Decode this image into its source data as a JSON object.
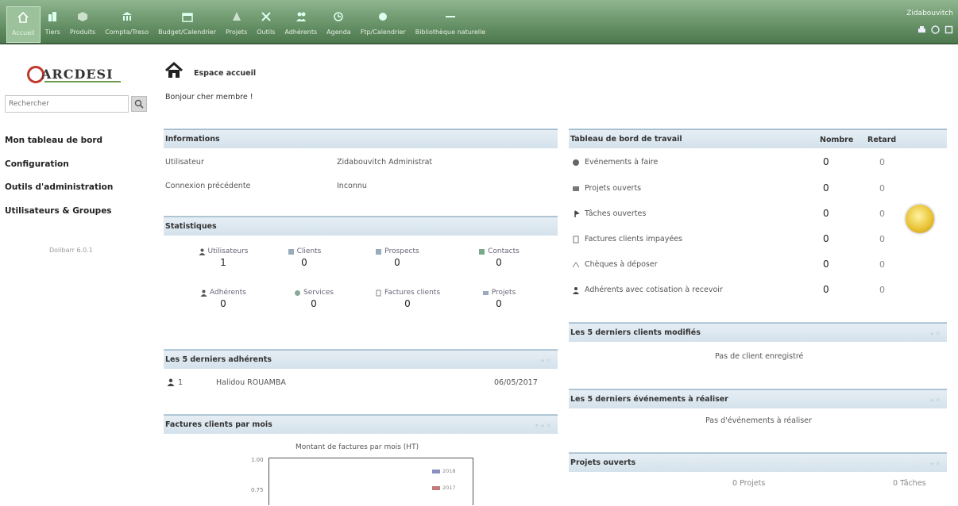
{
  "topbar": {
    "menu": [
      {
        "label": "Accueil",
        "icon": "home-icon"
      },
      {
        "label": "Tiers",
        "icon": "company-icon"
      },
      {
        "label": "Produits",
        "icon": "box-icon"
      },
      {
        "label": "Compta/Treso",
        "icon": "bank-icon"
      },
      {
        "label": "Budget/Calendrier",
        "icon": "calendar-icon"
      },
      {
        "label": "Projets",
        "icon": "project-icon"
      },
      {
        "label": "Outils",
        "icon": "tools-icon"
      },
      {
        "label": "Adhérents",
        "icon": "members-icon"
      },
      {
        "label": "Agenda",
        "icon": "agenda-icon"
      },
      {
        "label": "Ftp/Calendrier",
        "icon": "ftp-icon"
      },
      {
        "label": "Bibliothèque naturelle",
        "icon": "library-icon"
      }
    ],
    "user": "Zidabouvitch"
  },
  "left": {
    "logo_text": "ARCDESI",
    "search_placeholder": "Rechercher",
    "links": [
      "Mon tableau de bord",
      "Configuration",
      "Outils d'administration",
      "Utilisateurs & Groupes"
    ],
    "version": "Dolibarr 6.0.1"
  },
  "page": {
    "title": "Espace accueil",
    "greeting": "Bonjour cher membre !"
  },
  "informations": {
    "title": "Informations",
    "rows": [
      {
        "label": "Utilisateur",
        "value": "Zidabouvitch Administrat"
      },
      {
        "label": "Connexion précédente",
        "value": "Inconnu"
      }
    ]
  },
  "statistiques": {
    "title": "Statistiques",
    "items": [
      {
        "label": "Utilisateurs",
        "value": "1",
        "icon": "user-icon"
      },
      {
        "label": "Clients",
        "value": "0",
        "icon": "clients-icon"
      },
      {
        "label": "Prospects",
        "value": "0",
        "icon": "prospects-icon"
      },
      {
        "label": "Contacts",
        "value": "0",
        "icon": "contacts-icon"
      },
      {
        "label": "Adhérents",
        "value": "0",
        "icon": "member-icon"
      },
      {
        "label": "Services",
        "value": "0",
        "icon": "services-icon"
      },
      {
        "label": "Factures clients",
        "value": "0",
        "icon": "invoice-icon"
      },
      {
        "label": "Projets",
        "value": "0",
        "icon": "projects-icon"
      }
    ]
  },
  "adherents": {
    "title": "Les 5 derniers adhérents",
    "rows": [
      {
        "id": "1",
        "name": "Halidou ROUAMBA",
        "date": "06/05/2017"
      }
    ]
  },
  "factures": {
    "title": "Factures clients par mois",
    "chart_title": "Montant de factures par mois (HT)",
    "yticks": [
      "1.00",
      "0.75"
    ],
    "legend": [
      "2018",
      "2017"
    ]
  },
  "tableau": {
    "title": "Tableau de bord de travail",
    "col_nombre": "Nombre",
    "col_retard": "Retard",
    "rows": [
      {
        "label": "Evénements à faire",
        "nombre": "0",
        "retard": "0",
        "icon": "calendar-icon"
      },
      {
        "label": "Projets ouverts",
        "nombre": "0",
        "retard": "0",
        "icon": "project-icon"
      },
      {
        "label": "Tâches ouvertes",
        "nombre": "0",
        "retard": "0",
        "icon": "task-icon"
      },
      {
        "label": "Factures clients impayées",
        "nombre": "0",
        "retard": "0",
        "icon": "invoice-icon"
      },
      {
        "label": "Chèques à déposer",
        "nombre": "0",
        "retard": "0",
        "icon": "cheque-icon"
      },
      {
        "label": "Adhérents avec cotisation à recevoir",
        "nombre": "0",
        "retard": "0",
        "icon": "member-icon"
      }
    ]
  },
  "clients": {
    "title": "Les 5 derniers clients modifiés",
    "empty": "Pas de client enregistré"
  },
  "evenements": {
    "title": "Les 5 derniers événements à réaliser",
    "empty": "Pas d'événements à réaliser"
  },
  "projets": {
    "title": "Projets ouverts",
    "projets_count": "0 Projets",
    "taches_count": "0 Tâches"
  },
  "colors": {
    "topbar": "#5f8a5f",
    "box_header": "#d4e2ec",
    "legend_2018": "#8a8fc0",
    "legend_2017": "#c07a7a"
  }
}
